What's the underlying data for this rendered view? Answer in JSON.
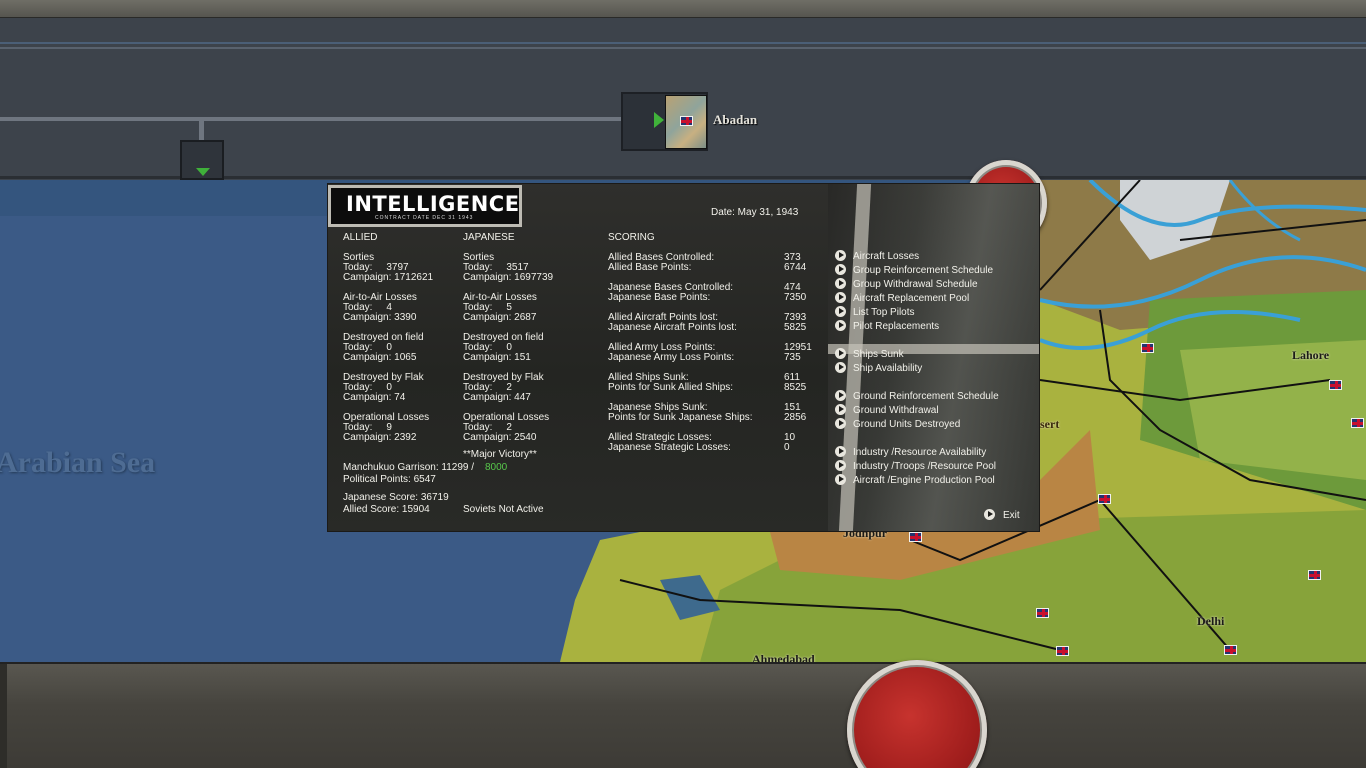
{
  "top_bar": {
    "base_name": "Abadan"
  },
  "map": {
    "sea_label": "Arabian Sea",
    "cities": {
      "lahore": "Lahore",
      "jodhpur": "Jodhpur",
      "delhi": "Delhi",
      "ahmedabad": "Ahmedabad",
      "desert_fragment": "sert"
    }
  },
  "panel": {
    "logo_title": "INTELLIGENCE",
    "logo_subtitle": "CONTRACT DATE DEC 31 1943",
    "date": "Date: May 31, 1943",
    "headers": {
      "allied": "ALLIED",
      "japanese": "JAPANESE",
      "scoring": "SCORING"
    },
    "allied": {
      "sorties": {
        "label": "Sorties",
        "today": "Today:     3797",
        "campaign": "Campaign: 1712621"
      },
      "air_to_air": {
        "label": "Air-to-Air Losses",
        "today": "Today:     4",
        "campaign": "Campaign: 3390"
      },
      "destroyed_field": {
        "label": "Destroyed on field",
        "today": "Today:     0",
        "campaign": "Campaign: 1065"
      },
      "destroyed_flak": {
        "label": "Destroyed by Flak",
        "today": "Today:     0",
        "campaign": "Campaign: 74"
      },
      "operational": {
        "label": "Operational Losses",
        "today": "Today:     9",
        "campaign": "Campaign: 2392"
      }
    },
    "japanese": {
      "sorties": {
        "label": "Sorties",
        "today": "Today:     3517",
        "campaign": "Campaign: 1697739"
      },
      "air_to_air": {
        "label": "Air-to-Air Losses",
        "today": "Today:     5",
        "campaign": "Campaign: 2687"
      },
      "destroyed_field": {
        "label": "Destroyed on field",
        "today": "Today:     0",
        "campaign": "Campaign: 151"
      },
      "destroyed_flak": {
        "label": "Destroyed by Flak",
        "today": "Today:     2",
        "campaign": "Campaign: 447"
      },
      "operational": {
        "label": "Operational Losses",
        "today": "Today:     2",
        "campaign": "Campaign: 2540"
      }
    },
    "result": "**Major Victory**",
    "manchukuo_label": "Manchukuo Garrison: 11299 /",
    "manchukuo_required": "8000",
    "political_points": "Political Points: 6547",
    "japanese_score": "Japanese Score: 36719",
    "allied_score": "Allied Score: 15904",
    "soviets": "Soviets Not Active",
    "scoring": [
      {
        "label1": "Allied Bases Controlled:",
        "val1": "373",
        "label2": "Allied Base Points:",
        "val2": "6744"
      },
      {
        "label1": "Japanese Bases Controlled:",
        "val1": "474",
        "label2": "Japanese Base Points:",
        "val2": "7350"
      },
      {
        "label1": "Allied Aircraft Points lost:",
        "val1": "7393",
        "label2": "Japanese Aircraft Points lost:",
        "val2": "5825"
      },
      {
        "label1": "Allied Army Loss Points:",
        "val1": "12951",
        "label2": "Japanese Army Loss Points:",
        "val2": "735"
      },
      {
        "label1": "Allied Ships Sunk:",
        "val1": "611",
        "label2": "Points for Sunk Allied Ships:",
        "val2": "8525"
      },
      {
        "label1": "Japanese Ships Sunk:",
        "val1": "151",
        "label2": "Points for Sunk Japanese Ships:",
        "val2": "2856"
      },
      {
        "label1": "Allied Strategic Losses:",
        "val1": "10",
        "label2": "Japanese Strategic Losses:",
        "val2": "0"
      }
    ],
    "links": {
      "aircraft_losses": "Aircraft Losses",
      "group_reinforcement": "Group Reinforcement Schedule",
      "group_withdrawal": "Group Withdrawal Schedule",
      "aircraft_replacement": "Aircraft Replacement Pool",
      "top_pilots": "List Top Pilots",
      "pilot_replacements": "Pilot Replacements",
      "ships_sunk": "Ships Sunk",
      "ship_availability": "Ship Availability",
      "ground_reinforcement": "Ground Reinforcement Schedule",
      "ground_withdrawal": "Ground Withdrawal",
      "ground_destroyed": "Ground Units Destroyed",
      "industry_availability": "Industry /Resource Availability",
      "industry_pool": "Industry /Troops /Resource Pool",
      "aircraft_engine": "Aircraft /Engine Production Pool",
      "exit": "Exit"
    }
  }
}
